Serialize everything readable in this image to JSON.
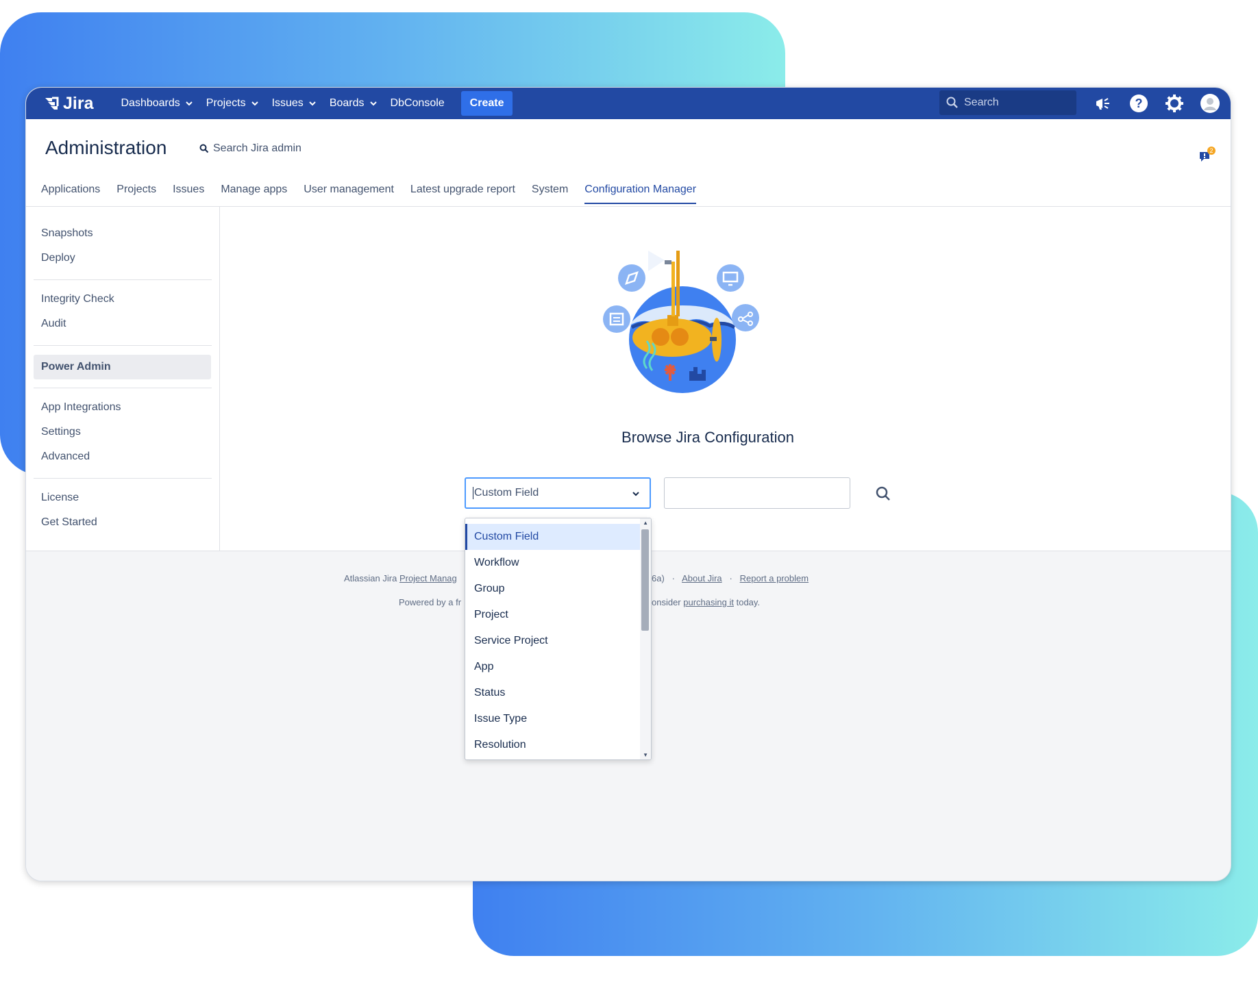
{
  "nav": {
    "logo_text": "Jira",
    "items": [
      {
        "label": "Dashboards",
        "has_dropdown": true
      },
      {
        "label": "Projects",
        "has_dropdown": true
      },
      {
        "label": "Issues",
        "has_dropdown": true
      },
      {
        "label": "Boards",
        "has_dropdown": true
      },
      {
        "label": "DbConsole",
        "has_dropdown": false
      }
    ],
    "create_label": "Create",
    "search_placeholder": "Search",
    "icons": [
      "megaphone-icon",
      "help-icon",
      "gear-icon",
      "avatar-icon"
    ],
    "color": "#2249a3"
  },
  "header": {
    "title": "Administration",
    "search_label": "Search Jira admin",
    "feedback_badge": "2"
  },
  "tabs": [
    {
      "label": "Applications",
      "active": false
    },
    {
      "label": "Projects",
      "active": false
    },
    {
      "label": "Issues",
      "active": false
    },
    {
      "label": "Manage apps",
      "active": false
    },
    {
      "label": "User management",
      "active": false
    },
    {
      "label": "Latest upgrade report",
      "active": false
    },
    {
      "label": "System",
      "active": false
    },
    {
      "label": "Configuration Manager",
      "active": true
    }
  ],
  "sidebar": {
    "groups": [
      [
        "Snapshots",
        "Deploy"
      ],
      [
        "Integrity Check",
        "Audit"
      ],
      [
        "Power Admin"
      ],
      [
        "App Integrations",
        "Settings",
        "Advanced"
      ],
      [
        "License",
        "Get Started"
      ]
    ],
    "active": "Power Admin"
  },
  "main": {
    "title": "Browse Jira Configuration",
    "select_value": "Custom Field",
    "dropdown_options": [
      "Custom Field",
      "Workflow",
      "Group",
      "Project",
      "Service Project",
      "App",
      "Status",
      "Issue Type",
      "Resolution"
    ],
    "selected_option": "Custom Field"
  },
  "footer": {
    "line1_prefix": "Atlassian Jira",
    "line1_link": "Project Manag",
    "line1_suffix": "6a)",
    "about_link": "About Jira",
    "report_link": "Report a problem",
    "line2_prefix": "Powered by a fr",
    "line2_mid": "onsider",
    "line2_link": "purchasing it",
    "line2_suffix": "today."
  }
}
